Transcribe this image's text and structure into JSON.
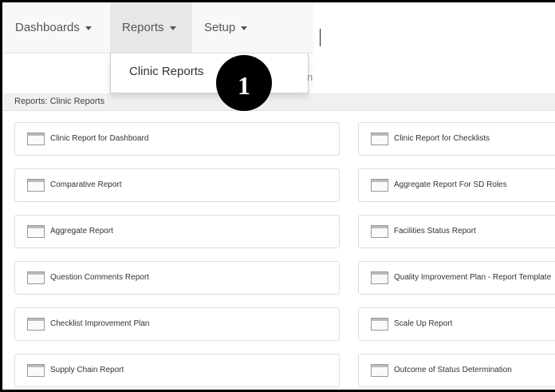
{
  "navbar": {
    "items": [
      {
        "label": "Dashboards"
      },
      {
        "label": "Reports"
      },
      {
        "label": "Setup"
      }
    ]
  },
  "dropdown": {
    "item": "Clinic Reports",
    "ghost_text": "n"
  },
  "badge": {
    "number": "1"
  },
  "breadcrumb": "Reports: Clinic Reports",
  "reports": {
    "left": [
      "Clinic Report for Dashboard",
      "Comparative Report",
      "Aggregate Report",
      "Question Comments Report",
      "Checklist Improvement Plan",
      "Supply Chain Report"
    ],
    "right": [
      "Clinic Report for Checklists",
      "Aggregate Report For SD Roles",
      "Facilities Status Report",
      "Quality Improvement Plan - Report Template",
      "Scale Up Report",
      "Outcome of Status Determination"
    ]
  },
  "icons": {
    "card": "report-page-icon",
    "caret": "caret-down-icon"
  }
}
